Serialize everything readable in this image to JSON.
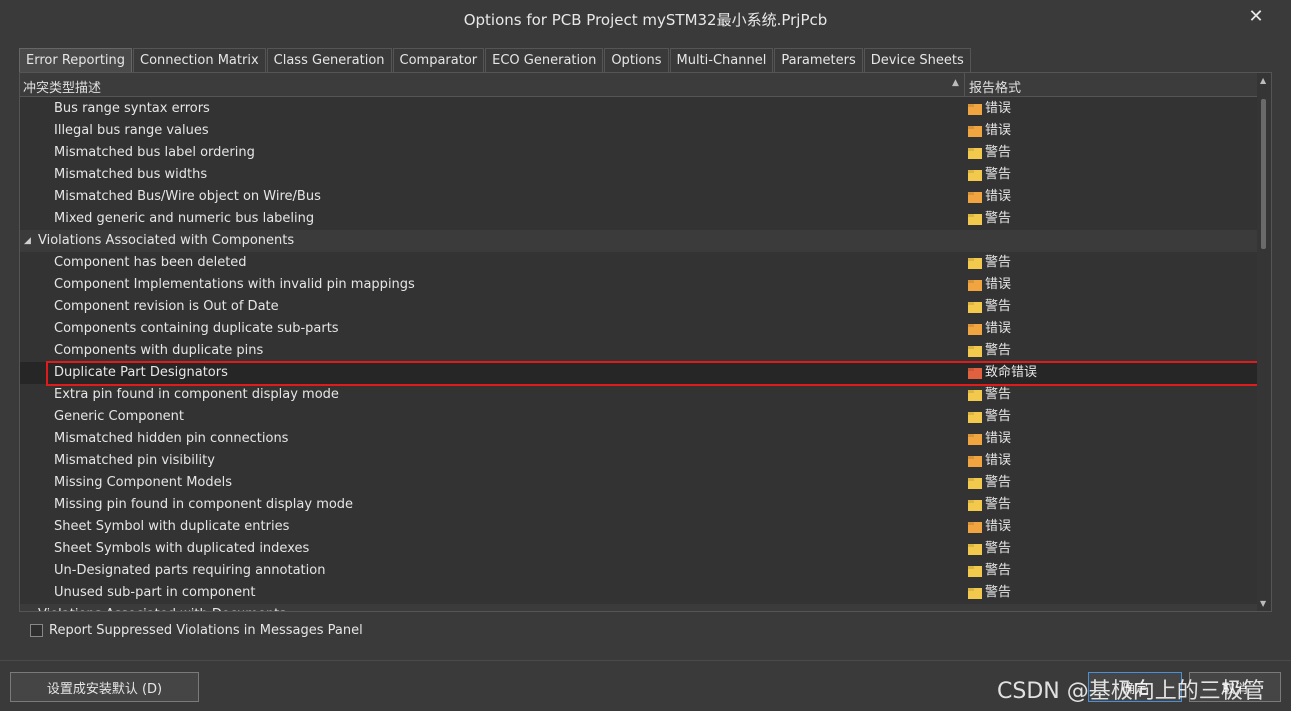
{
  "window": {
    "title": "Options for PCB Project mySTM32最小系统.PrjPcb",
    "close_glyph": "✕"
  },
  "tabs": [
    {
      "label": "Error Reporting",
      "active": true
    },
    {
      "label": "Connection Matrix",
      "active": false
    },
    {
      "label": "Class Generation",
      "active": false
    },
    {
      "label": "Comparator",
      "active": false
    },
    {
      "label": "ECO Generation",
      "active": false
    },
    {
      "label": "Options",
      "active": false
    },
    {
      "label": "Multi-Channel",
      "active": false
    },
    {
      "label": "Parameters",
      "active": false
    },
    {
      "label": "Device Sheets",
      "active": false
    }
  ],
  "table": {
    "col_description": "冲突类型描述",
    "col_format": "报告格式",
    "sort_glyph": "▲",
    "rows": [
      {
        "type": "item",
        "desc": "Bus range syntax errors",
        "level": "err",
        "format": "错误"
      },
      {
        "type": "item",
        "desc": "Illegal bus range values",
        "level": "err",
        "format": "错误"
      },
      {
        "type": "item",
        "desc": "Mismatched bus label ordering",
        "level": "warn",
        "format": "警告"
      },
      {
        "type": "item",
        "desc": "Mismatched bus widths",
        "level": "warn",
        "format": "警告"
      },
      {
        "type": "item",
        "desc": "Mismatched Bus/Wire object on Wire/Bus",
        "level": "err",
        "format": "错误"
      },
      {
        "type": "item",
        "desc": "Mixed generic and numeric bus labeling",
        "level": "warn",
        "format": "警告"
      },
      {
        "type": "group",
        "desc": "Violations Associated with Components",
        "arrow": "◢"
      },
      {
        "type": "item",
        "desc": "Component has been deleted",
        "level": "warn",
        "format": "警告"
      },
      {
        "type": "item",
        "desc": "Component Implementations with invalid pin mappings",
        "level": "err",
        "format": "错误"
      },
      {
        "type": "item",
        "desc": "Component revision is Out of Date",
        "level": "warn",
        "format": "警告"
      },
      {
        "type": "item",
        "desc": "Components containing duplicate sub-parts",
        "level": "err",
        "format": "错误"
      },
      {
        "type": "item",
        "desc": "Components with duplicate pins",
        "level": "warn",
        "format": "警告"
      },
      {
        "type": "item",
        "desc": "Duplicate Part Designators",
        "level": "fatal",
        "format": "致命错误",
        "selected": true
      },
      {
        "type": "item",
        "desc": "Extra pin found in component display mode",
        "level": "warn",
        "format": "警告"
      },
      {
        "type": "item",
        "desc": "Generic Component",
        "level": "warn",
        "format": "警告"
      },
      {
        "type": "item",
        "desc": "Mismatched hidden pin connections",
        "level": "err",
        "format": "错误"
      },
      {
        "type": "item",
        "desc": "Mismatched pin visibility",
        "level": "err",
        "format": "错误"
      },
      {
        "type": "item",
        "desc": "Missing Component Models",
        "level": "warn",
        "format": "警告"
      },
      {
        "type": "item",
        "desc": "Missing pin found in component display mode",
        "level": "warn",
        "format": "警告"
      },
      {
        "type": "item",
        "desc": "Sheet Symbol with duplicate entries",
        "level": "err",
        "format": "错误"
      },
      {
        "type": "item",
        "desc": "Sheet Symbols with duplicated indexes",
        "level": "warn",
        "format": "警告"
      },
      {
        "type": "item",
        "desc": "Un-Designated parts requiring annotation",
        "level": "warn",
        "format": "警告"
      },
      {
        "type": "item",
        "desc": "Unused sub-part in component",
        "level": "warn",
        "format": "警告"
      },
      {
        "type": "group",
        "desc": "Violations Associated with Documents",
        "arrow": "◢"
      }
    ]
  },
  "options": {
    "report_suppressed_label": "Report Suppressed Violations in Messages Panel",
    "report_suppressed_checked": false
  },
  "buttons": {
    "set_default": "设置成安装默认 (D)",
    "ok": "确定",
    "cancel": "取消"
  },
  "watermark": "CSDN @基极向上的三极管",
  "colors": {
    "warn": "#f2c94c",
    "err": "#f0a541",
    "fatal": "#e0603f",
    "highlight": "#e01b1b"
  }
}
